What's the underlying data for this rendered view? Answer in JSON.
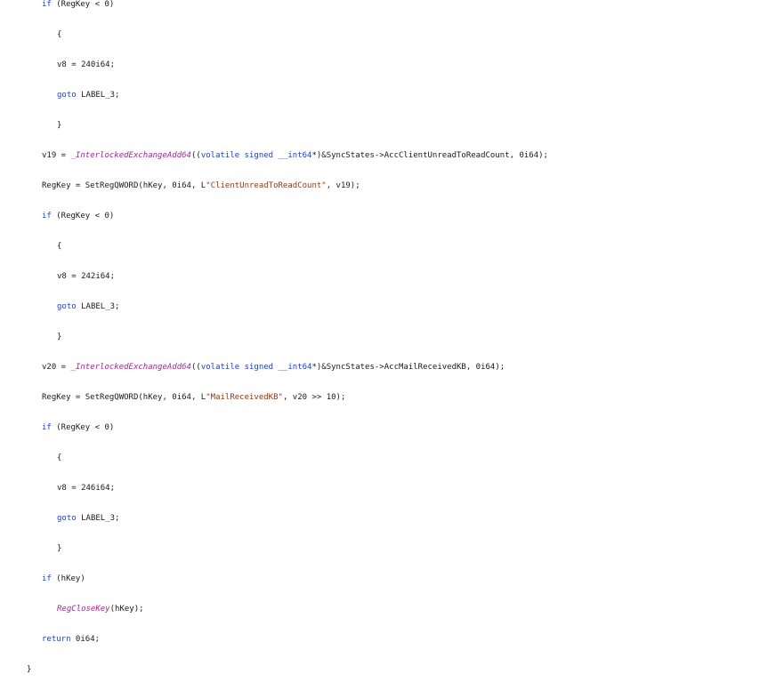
{
  "lines": [
    {
      "parts": [
        {
          "t": "kw",
          "s": "if"
        },
        {
          "t": "plain",
          "s": " (RegKey < 0)"
        }
      ]
    },
    {
      "parts": [
        {
          "t": "plain",
          "s": "{"
        }
      ]
    },
    {
      "parts": [
        {
          "t": "plain",
          "s": "v8 = 240i64;"
        }
      ]
    },
    {
      "parts": [
        {
          "t": "kw",
          "s": "goto"
        },
        {
          "t": "plain",
          "s": " LABEL_3;"
        }
      ]
    },
    {
      "parts": [
        {
          "t": "plain",
          "s": "}"
        }
      ]
    },
    {
      "parts": [
        {
          "t": "plain",
          "s": "v19 = "
        },
        {
          "t": "fn",
          "s": "_InterlockedExchangeAdd64"
        },
        {
          "t": "plain",
          "s": "(("
        },
        {
          "t": "kw",
          "s": "volatile signed __int64"
        },
        {
          "t": "plain",
          "s": "*)&SyncStates->AccClientUnreadToReadCount, 0i64);"
        }
      ]
    },
    {
      "parts": [
        {
          "t": "plain",
          "s": "RegKey = SetRegQWORD(hKey, 0i64, L"
        },
        {
          "t": "str",
          "s": "\"ClientUnreadToReadCount\""
        },
        {
          "t": "plain",
          "s": ", v19);"
        }
      ]
    },
    {
      "parts": [
        {
          "t": "kw",
          "s": "if"
        },
        {
          "t": "plain",
          "s": " (RegKey < 0)"
        }
      ]
    },
    {
      "parts": [
        {
          "t": "plain",
          "s": "{"
        }
      ]
    },
    {
      "parts": [
        {
          "t": "plain",
          "s": "v8 = 242i64;"
        }
      ]
    },
    {
      "parts": [
        {
          "t": "kw",
          "s": "goto"
        },
        {
          "t": "plain",
          "s": " LABEL_3;"
        }
      ]
    },
    {
      "parts": [
        {
          "t": "plain",
          "s": "}"
        }
      ]
    },
    {
      "parts": [
        {
          "t": "plain",
          "s": "v20 = "
        },
        {
          "t": "fn",
          "s": "_InterlockedExchangeAdd64"
        },
        {
          "t": "plain",
          "s": "(("
        },
        {
          "t": "kw",
          "s": "volatile signed __int64"
        },
        {
          "t": "plain",
          "s": "*)&SyncStates->AccMailReceivedKB, 0i64);"
        }
      ]
    },
    {
      "parts": [
        {
          "t": "plain",
          "s": "RegKey = SetRegQWORD(hKey, 0i64, L"
        },
        {
          "t": "str",
          "s": "\"MailReceivedKB\""
        },
        {
          "t": "plain",
          "s": ", v20 >> 10);"
        }
      ]
    },
    {
      "parts": [
        {
          "t": "kw",
          "s": "if"
        },
        {
          "t": "plain",
          "s": " (RegKey < 0)"
        }
      ]
    },
    {
      "parts": [
        {
          "t": "plain",
          "s": "{"
        }
      ]
    },
    {
      "parts": [
        {
          "t": "plain",
          "s": "v8 = 246i64;"
        }
      ]
    },
    {
      "parts": [
        {
          "t": "kw",
          "s": "goto"
        },
        {
          "t": "plain",
          "s": " LABEL_3;"
        }
      ]
    },
    {
      "parts": [
        {
          "t": "plain",
          "s": "}"
        }
      ]
    },
    {
      "parts": [
        {
          "t": "kw",
          "s": "if"
        },
        {
          "t": "plain",
          "s": " (hKey)"
        }
      ]
    },
    {
      "parts": [
        {
          "t": "fn",
          "s": "RegCloseKey"
        },
        {
          "t": "plain",
          "s": "(hKey);"
        }
      ]
    },
    {
      "parts": [
        {
          "t": "kw",
          "s": "return"
        },
        {
          "t": "plain",
          "s": " 0i64;"
        }
      ]
    },
    {
      "parts": [
        {
          "t": "plain",
          "s": "}"
        }
      ]
    }
  ]
}
